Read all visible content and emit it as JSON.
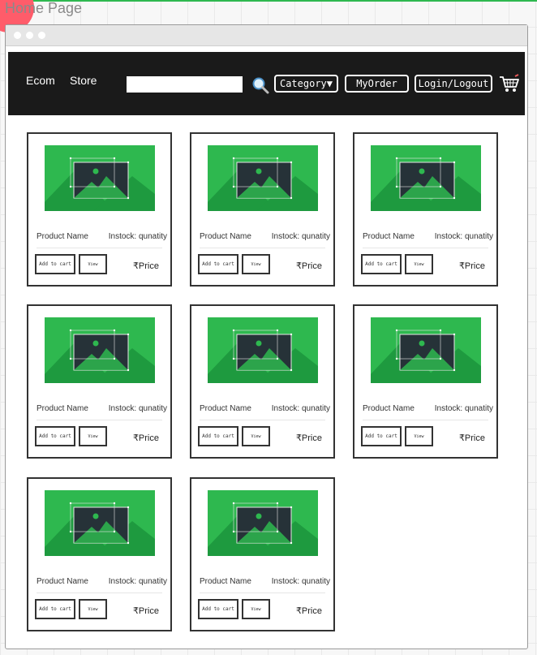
{
  "page_title": "Home Page",
  "nav": {
    "brand": "Ecom",
    "store": "Store",
    "search_placeholder": "",
    "category_label": "Category▼",
    "myorder_label": "MyOrder",
    "login_label": "Login/Logout"
  },
  "products": [
    {
      "name": "Product Name",
      "stock": "Instock: qunatity",
      "add_label": "Add to cart",
      "view_label": "View",
      "price": "₹Price"
    },
    {
      "name": "Product Name",
      "stock": "Instock: qunatity",
      "add_label": "Add to cart",
      "view_label": "View",
      "price": "₹Price"
    },
    {
      "name": "Product Name",
      "stock": "Instock: qunatity",
      "add_label": "Add to cart",
      "view_label": "View",
      "price": "₹Price"
    },
    {
      "name": "Product Name",
      "stock": "Instock: qunatity",
      "add_label": "Add to cart",
      "view_label": "View",
      "price": "₹Price"
    },
    {
      "name": "Product Name",
      "stock": "Instock: qunatity",
      "add_label": "Add to cart",
      "view_label": "View",
      "price": "₹Price"
    },
    {
      "name": "Product Name",
      "stock": "Instock: qunatity",
      "add_label": "Add to cart",
      "view_label": "View",
      "price": "₹Price"
    },
    {
      "name": "Product Name",
      "stock": "Instock: qunatity",
      "add_label": "Add to cart",
      "view_label": "View",
      "price": "₹Price"
    },
    {
      "name": "Product Name",
      "stock": "Instock: qunatity",
      "add_label": "Add to cart",
      "view_label": "View",
      "price": "₹Price"
    }
  ],
  "colors": {
    "navbar": "#1a1a1a",
    "image_green": "#2eb84f",
    "image_dark": "#263238"
  }
}
